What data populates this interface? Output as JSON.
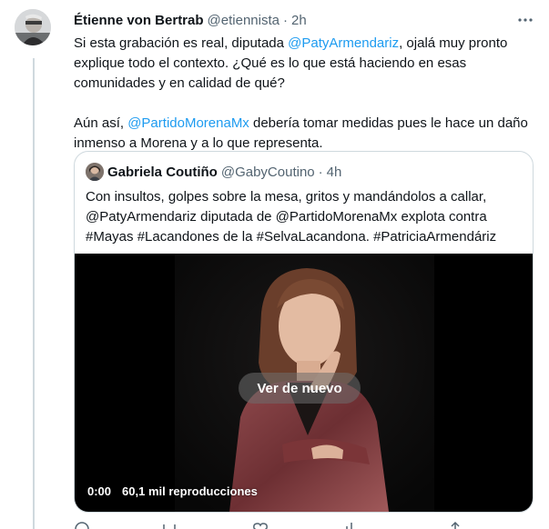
{
  "tweet": {
    "author_name": "Étienne von Bertrab",
    "author_handle": "@etiennista",
    "separator": "·",
    "time": "2h",
    "text_part1": "Si esta grabación es real, diputada ",
    "mention1": "@PatyArmendariz",
    "text_part2": ", ojalá muy pronto explique todo el contexto. ¿Qué es lo que está haciendo en esas comunidades y en calidad de qué?",
    "text_part3": "Aún así, ",
    "mention2": "@PartidoMorenaMx",
    "text_part4": " debería tomar medidas pues le hace un daño inmenso a Morena y a lo que representa.",
    "more_icon": "more-horizontal-icon"
  },
  "quote": {
    "author_name": "Gabriela Coutiño",
    "author_handle": "@GabyCoutino",
    "separator": "·",
    "time": "4h",
    "text": "Con insultos, golpes sobre la mesa, gritos y mandándolos a callar, @PatyArmendariz diputada de @PartidoMorenaMx explota contra #Mayas #Lacandones de la #SelvaLacandona. #PatriciaArmendáriz",
    "video": {
      "replay_label": "Ver de nuevo",
      "time": "0:00",
      "views": "60,1 mil reproducciones"
    }
  },
  "colors": {
    "link": "#1d9bf0",
    "text": "#0f1419",
    "secondary": "#536471",
    "border": "#cfd9de"
  }
}
